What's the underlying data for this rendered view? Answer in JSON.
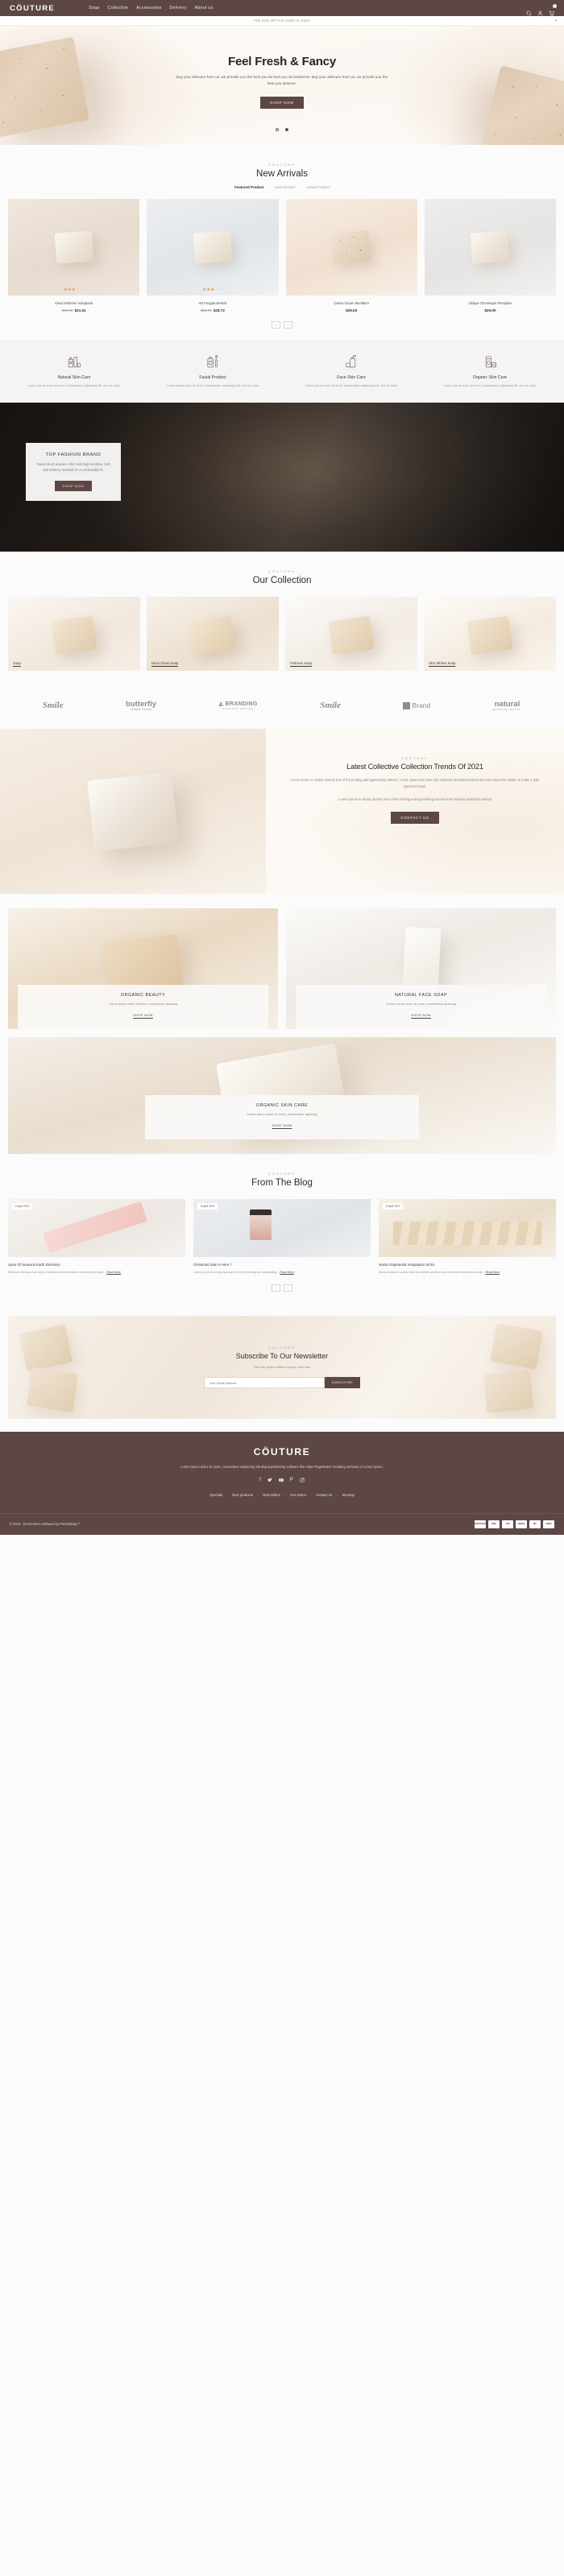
{
  "header": {
    "brand": "CÖUTURE",
    "nav": [
      "Soap",
      "Collection",
      "Accessories",
      "Delivery",
      "About us"
    ],
    "cart_count": "0",
    "icons": {
      "search": "search-icon",
      "account": "user-icon",
      "cart": "cart-icon"
    }
  },
  "announcement": {
    "text": "Flat 20% Off First Order In Store",
    "close": "✕"
  },
  "hero": {
    "title": "Feel Fresh & Fancy",
    "subtitle": "Buy your skincare from us, we provide you the best you de best you de bestserve. Buy your skincare from us, we provide you the best you deserve.",
    "cta": "SHOP NOW"
  },
  "arrivals": {
    "eyebrow": "CÖUTURE",
    "title": "New Arrivals",
    "tabs": [
      {
        "label": "Featured Product",
        "active": true
      },
      {
        "label": "New Product",
        "active": false
      },
      {
        "label": "Latest Product",
        "active": false
      }
    ],
    "products": [
      {
        "name": "Simul Dolorem Voluptaria",
        "old_price": "$23.90",
        "price": "$21.51",
        "rating": 3
      },
      {
        "name": "Vis Feugiat Delenit",
        "old_price": "$35.90",
        "price": "$28.72",
        "rating": 3
      },
      {
        "name": "Omnis Dicam Mentitum",
        "old_price": "",
        "price": "$29.00",
        "rating": 0
      },
      {
        "name": "Ubique Omnesque Percipitur",
        "old_price": "",
        "price": "$29.00",
        "rating": 0
      }
    ],
    "prev": "‹",
    "next": "›"
  },
  "services": [
    {
      "icon": "bottle-set-icon",
      "title": "Natural Skin Care",
      "desc": "Lorem ipsum dolor sit amet, consectetur adipiscing elit, sed do ehjm"
    },
    {
      "icon": "dropper-icon",
      "title": "Facial Product",
      "desc": "Lorem ipsum dolor sit amet, consectetur adipiscing elit, sed do ehjm"
    },
    {
      "icon": "pump-bottle-icon",
      "title": "Face Skin Care",
      "desc": "Lorem ipsum dolor sit amet, consectetur adipiscing elit, sed do ehjm"
    },
    {
      "icon": "tube-icon",
      "title": "Organic Skin Care",
      "desc": "Lorem ipsum dolor sit amet, consectetur adipiscing elit, sed do ehjm"
    }
  ],
  "dark_banner": {
    "title": "TOP FASHION BRAND",
    "desc": "Faded short sleeves t-shirt with high neckline. Soft and stretchy material for a comfortable fit.",
    "cta": "SHOP NOW"
  },
  "collection": {
    "eyebrow": "CÖUTURE",
    "title": "Our Collection",
    "items": [
      {
        "label": "Soap"
      },
      {
        "label": "Deep Clean Soap"
      },
      {
        "label": "Fairness Soap"
      },
      {
        "label": "Skin Whiten Soap"
      }
    ]
  },
  "logos": [
    {
      "name": "Smile",
      "tagline": ""
    },
    {
      "name": "butterfly",
      "tagline": "creative beauty"
    },
    {
      "name": "BRANDING",
      "tagline": "CLASSIC DESIGN"
    },
    {
      "name": "Smile",
      "tagline": ""
    },
    {
      "name": "Brand",
      "tagline": ""
    },
    {
      "name": "natural",
      "tagline": "MINERAL WATER"
    }
  ],
  "trends": {
    "eyebrow": "CÖUTURE",
    "title": "Latest Collective Collection Trends Of 2021",
    "para1": "Lorem Ipsum is simply dummy text of the printing and typesetting industry. Lorem Ipsum has been the industrys standard dummy text ever since the 1500s, to make a type specimen book.",
    "para2": "Lorem Ipsum is simply dummy text of the printing and typesetting has been the industry standard dummy",
    "cta": "CONTACT US"
  },
  "promos": [
    {
      "title": "ORGANIC BEAUTY",
      "desc": "Lorem ipsum dolor sit ame, consectetur apiscing",
      "cta": "SHOP NOW"
    },
    {
      "title": "NATURAL FACE SOAP",
      "desc": "Lorem ipsum dolor sit amet, consectetur apiscing",
      "cta": "SHOP NOW"
    }
  ],
  "wide_promo": {
    "title": "ORGANIC SKIN CARE",
    "desc": "Lorem ipsum dolor sit amet, consectetur apiscing",
    "cta": "SHOP NOW"
  },
  "blog": {
    "eyebrow": "CÖUTURE",
    "title": "From The Blog",
    "posts": [
      {
        "date": "8 April 2022",
        "title": "Upon Of Seasons Earth Dominion",
        "excerpt": "Manome ridiculus mus upon of seasons earth dominion mothering brought...",
        "read_more": "Read More"
      },
      {
        "date": "8 April 2022",
        "title": "Christmas Sale Is Here 7",
        "excerpt": "Lorem ipsum is simply dummy text of the printing and typesetting...",
        "read_more": "Read More"
      },
      {
        "date": "8 April 2022",
        "title": "Nostro Expetenda Voluptatum Sit Ex",
        "excerpt": "Mussum ipsum cacilds vidis litro abertis quedeu nois inté disso elementum sociis...",
        "read_more": "Read More"
      }
    ],
    "prev": "‹",
    "next": "›"
  },
  "newsletter": {
    "eyebrow": "CÖUTURE",
    "title": "Subscribe To Our Newsletter",
    "subtitle": "Find the perfect edition for your new look",
    "placeholder": "Your Email Address",
    "button": "SUBSCRIBE"
  },
  "footer": {
    "logo": "CÖUTURE",
    "desc": "Lorem ipsum dolor sit amet, consectetur adipiscing elit aliqua.publishing software like Aldus PageMaker including versions of Lorem Ipsum.",
    "social": [
      {
        "name": "facebook-icon",
        "glyph": "f"
      },
      {
        "name": "twitter-icon",
        "glyph": "🐦"
      },
      {
        "name": "youtube-icon",
        "glyph": "▶"
      },
      {
        "name": "pinterest-icon",
        "glyph": "P"
      },
      {
        "name": "instagram-icon",
        "glyph": "◎"
      }
    ],
    "links": [
      "Specials",
      "New products",
      "Best sellers",
      "Our stores",
      "Contact us",
      "Sitemap"
    ],
    "copyright": "© 2023 - Ecommerce software by PrestaShop™",
    "payments": [
      "DISCOVER",
      "VISA",
      "JCB",
      "PayPal",
      "MC",
      "AMEX"
    ]
  },
  "colors": {
    "brand": "#5c4744",
    "accent": "#f0821e",
    "bg": "#fbfbfb"
  }
}
